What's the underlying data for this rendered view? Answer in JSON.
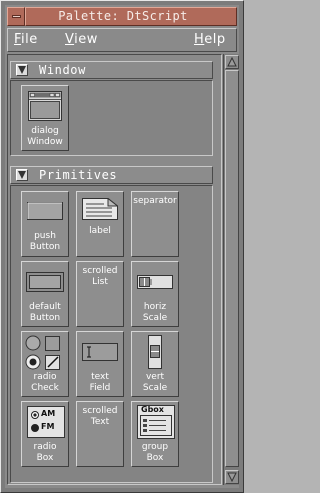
{
  "window": {
    "title": "Palette: DtScript"
  },
  "menubar": {
    "file": {
      "first": "F",
      "rest": "ile"
    },
    "view": {
      "first": "V",
      "rest": "iew"
    },
    "help": {
      "first": "H",
      "rest": "elp"
    }
  },
  "sections": {
    "window": {
      "label": "Window",
      "items": [
        {
          "line1": "dialog",
          "line2": "Window",
          "icon": "dialog-window-icon"
        }
      ]
    },
    "primitives": {
      "label": "Primitives",
      "items": [
        {
          "line1": "push",
          "line2": "Button",
          "icon": "push-button-icon"
        },
        {
          "line1": "label",
          "line2": "",
          "icon": "label-icon"
        },
        {
          "line1": "separator",
          "line2": "",
          "icon": ""
        },
        {
          "line1": "default",
          "line2": "Button",
          "icon": "default-button-icon"
        },
        {
          "line1": "scrolled",
          "line2": "List",
          "icon": ""
        },
        {
          "line1": "horiz",
          "line2": "Scale",
          "icon": "horiz-scale-icon"
        },
        {
          "line1": "radio",
          "line2": "Check",
          "icon": "radio-check-icon"
        },
        {
          "line1": "text",
          "line2": "Field",
          "icon": "text-field-icon"
        },
        {
          "line1": "vert",
          "line2": "Scale",
          "icon": "vert-scale-icon"
        },
        {
          "line1": "radio",
          "line2": "Box",
          "icon": "radio-box-icon",
          "am": "AM",
          "fm": "FM"
        },
        {
          "line1": "scrolled",
          "line2": "Text",
          "icon": ""
        },
        {
          "line1": "group",
          "line2": "Box",
          "icon": "group-box-icon",
          "gbox": "Gbox"
        }
      ]
    }
  }
}
